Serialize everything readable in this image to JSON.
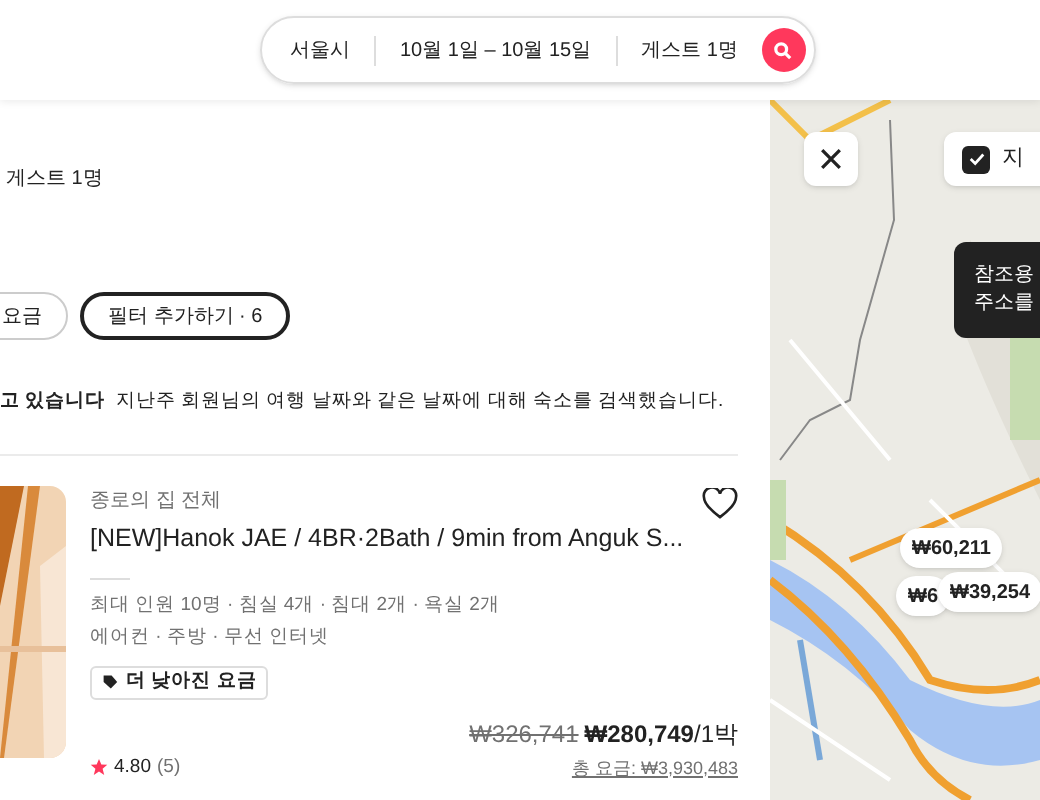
{
  "search": {
    "location": "서울시",
    "dates": "10월 1일 – 10월 15일",
    "guests": "게스트 1명"
  },
  "summary": "게스트 1명",
  "filters": [
    {
      "label": "요금",
      "emphasized": false
    },
    {
      "label": "필터 추가하기 · 6",
      "emphasized": true
    }
  ],
  "notice": {
    "title": "고 있습니다",
    "text": "지난주 회원님의 여행 날짜와 같은 날짜에 대해 숙소를 검색했습니다."
  },
  "listing": {
    "type": "종로의 집 전체",
    "title": "[NEW]Hanok JAE / 4BR·2Bath / 9min from Anguk S...",
    "rooms": "최대 인원 10명 · 침실 4개 · 침대 2개 · 욕실 2개",
    "amenities": "에어컨 · 주방 · 무선 인터넷",
    "badge": "더 낮아진 요금",
    "old_price": "₩326,741",
    "price": "₩280,749",
    "per": "/1박",
    "total": "총 요금: ₩3,930,483",
    "rating": "4.80",
    "reviews": "(5)",
    "favorite": false
  },
  "map": {
    "show_map_checked": true,
    "show_map_label": "지",
    "tooltip": [
      "참조용",
      "주소를"
    ],
    "pins": [
      {
        "label": "₩60,211"
      },
      {
        "label": "₩6"
      },
      {
        "label": "₩39,254"
      }
    ]
  }
}
